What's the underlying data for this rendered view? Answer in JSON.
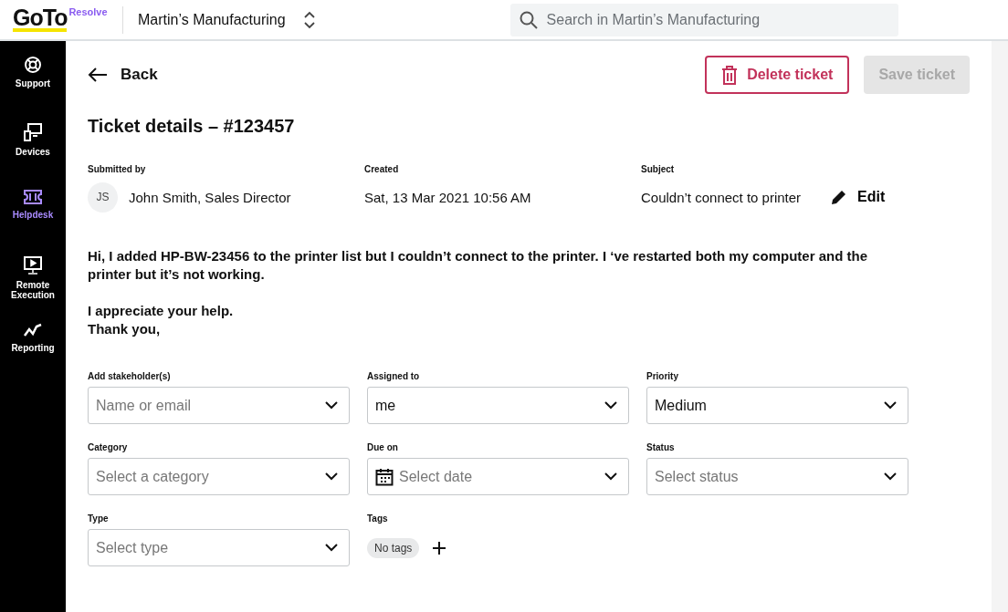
{
  "header": {
    "logo": "GoTo",
    "logo_badge": "Resolve",
    "company": "Martin’s Manufacturing",
    "search": {
      "placeholder": "Search in Martin’s Manufacturing"
    }
  },
  "sidebar": {
    "items": [
      {
        "label": "Support",
        "selected": false
      },
      {
        "label": "Devices",
        "selected": false
      },
      {
        "label": "Helpdesk",
        "selected": true
      },
      {
        "label": "Remote Execution",
        "selected": false
      },
      {
        "label": "Reporting",
        "selected": false
      }
    ]
  },
  "back": "Back",
  "delete_button": {
    "label": "Delete ticket"
  },
  "save_button": {
    "label": "Save ticket",
    "disabled": true
  },
  "title": "Ticket details – #123457",
  "meta": [
    {
      "label": "Submitted by",
      "value": "John Smith, Sales Director",
      "avatar": "JS",
      "kind": "person"
    },
    {
      "label": "Created",
      "value": "Sat, 13 Mar 2021 10:56 AM",
      "kind": "text"
    },
    {
      "label": "Subject",
      "value": "Couldn’t connect to printer",
      "edit": "Edit",
      "kind": "editable"
    }
  ],
  "message": [
    {
      "lines": [
        "Hi, I added HP-BW-23456 to the printer list but I couldn’t connect to the printer. I ‘ve restarted both my computer and the printer  but it’s not working."
      ]
    },
    {
      "lines": [
        "I appreciate your help.",
        "Thank you,"
      ]
    }
  ],
  "fields": [
    {
      "label": "Add stakeholder(s)",
      "placeholder": "Name or email",
      "kind": "select"
    },
    {
      "label": "Assigned to",
      "value": "me",
      "kind": "select"
    },
    {
      "label": "Priority",
      "value": "Medium",
      "kind": "select"
    },
    {
      "label": "Category",
      "placeholder": "Select a category",
      "kind": "select"
    },
    {
      "label": "Due on",
      "placeholder": "Select date",
      "kind": "date"
    },
    {
      "label": "Status",
      "placeholder": "Select status",
      "kind": "select"
    },
    {
      "label": "Type",
      "placeholder": "Select type",
      "kind": "select"
    },
    {
      "label": "Tags",
      "tags": [
        "No tags"
      ],
      "kind": "tags"
    }
  ]
}
